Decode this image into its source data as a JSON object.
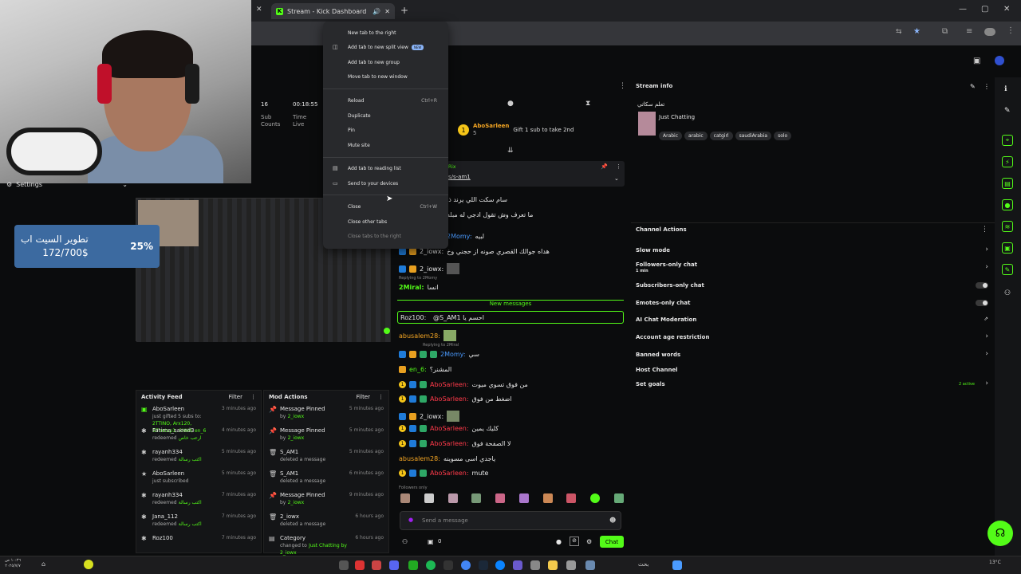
{
  "browser": {
    "tab_title": "Stream - Kick Dashboard",
    "close_tab_glyph": "✕",
    "new_tab_glyph": "+"
  },
  "context_menu": {
    "items": [
      {
        "label": "New tab to the right"
      },
      {
        "label": "Add tab to new split view",
        "badge": "NEW"
      },
      {
        "label": "Add tab to new group"
      },
      {
        "label": "Move tab to new window"
      },
      {
        "label": "Reload",
        "shortcut": "Ctrl+R"
      },
      {
        "label": "Duplicate"
      },
      {
        "label": "Pin"
      },
      {
        "label": "Mute site"
      },
      {
        "label": "Add tab to reading list"
      },
      {
        "label": "Send to your devices"
      },
      {
        "label": "Close",
        "shortcut": "Ctrl+W"
      },
      {
        "label": "Close other tabs"
      },
      {
        "label": "Close tabs to the right"
      }
    ]
  },
  "overlay": {
    "settings_label": "Settings",
    "goal_title": "تطوير السيت اب",
    "goal_amount": "172/700$",
    "goal_percent": "25%"
  },
  "stats": {
    "subs": "16",
    "subs_label": "Sub Counts",
    "time": "00:18:55",
    "time_label": "Time Live"
  },
  "activity_feed": {
    "title": "Activity Feed",
    "filter": "Filter",
    "items": [
      {
        "name": "AboSarleen",
        "desc": "just gifted 5 subs to:",
        "extra": "2TTINO, Arx120, B7ontop1, 6YAM, en_6",
        "time": "3 minutes ago"
      },
      {
        "name": "Fatima_saeed3",
        "desc": "redeemed",
        "extra": "ارعب خاص",
        "time": "4 minutes ago"
      },
      {
        "name": "rayanh334",
        "desc": "redeemed",
        "extra": "اكتب رسالة",
        "time": "5 minutes ago"
      },
      {
        "name": "AboSarleen",
        "desc": "just subscribed",
        "extra": "",
        "time": "5 minutes ago"
      },
      {
        "name": "rayanh334",
        "desc": "redeemed",
        "extra": "اكتب رسالة",
        "time": "7 minutes ago"
      },
      {
        "name": "Jana_112",
        "desc": "redeemed",
        "extra": "اكتب رسالة",
        "time": "7 minutes ago"
      },
      {
        "name": "Roz100",
        "desc": "",
        "extra": "",
        "time": "7 minutes ago"
      }
    ]
  },
  "mod_actions": {
    "title": "Mod Actions",
    "filter": "Filter",
    "items": [
      {
        "name": "Message Pinned",
        "desc": "by",
        "by": "2_iowx",
        "time": "5 minutes ago"
      },
      {
        "name": "Message Pinned",
        "desc": "by",
        "by": "2_iowx",
        "time": "5 minutes ago"
      },
      {
        "name": "S_AM1",
        "desc": "deleted a message",
        "by": "",
        "time": "5 minutes ago"
      },
      {
        "name": "S_AM1",
        "desc": "deleted a message",
        "by": "",
        "time": "6 minutes ago"
      },
      {
        "name": "Message Pinned",
        "desc": "by",
        "by": "2_iowx",
        "time": "9 minutes ago"
      },
      {
        "name": "2_iowx",
        "desc": "deleted a message",
        "by": "",
        "time": "6 hours ago"
      },
      {
        "name": "Category",
        "desc": "changed to",
        "by": "Just Chatting by 2_iowx",
        "time": "6 hours ago"
      }
    ]
  },
  "chat": {
    "gift_user": "AboSarleen",
    "gift_count": "5",
    "gift_text": "Gift 1 sub to take 2nd",
    "pinned_user": "Rix",
    "pinned_link": "s/s-am1",
    "new_messages": "New messages",
    "messages": [
      {
        "text": "سام سكت اللي يرند ذا"
      },
      {
        "text": "ما تعرف وش تقول ادجي له مبله"
      },
      {
        "user": "2Momy:",
        "text": "لبيه"
      },
      {
        "user": "2_iowx:",
        "text": "هداه جوالك القصري صونه از حجني وخ"
      },
      {
        "user": "2_iowx:",
        "text": ""
      },
      {
        "reply": "Replying to 2Momy",
        "user": "2Miral:",
        "text": "انسا"
      },
      {
        "user": "Roz100:",
        "text": "@S_AM1 احسم يا"
      },
      {
        "user": "abusalem28:",
        "text": ""
      },
      {
        "reply": "Replying to 2Miral",
        "user": "2Momy:",
        "text": "سي"
      },
      {
        "user": "en_6:",
        "text": "المشنر؟"
      },
      {
        "user": "AboSarleen:",
        "text": "من فوق تسوي ميوت"
      },
      {
        "user": "AboSarleen:",
        "text": "اضغط من فوق"
      },
      {
        "user": "2_iowx:",
        "text": ""
      },
      {
        "user": "AboSarleen:",
        "text": "كليك يمين"
      },
      {
        "user": "AboSarleen:",
        "text": "لا الصفحة فوق"
      },
      {
        "user": "abusalem28:",
        "text": "ياجدي اسى مسوينه"
      },
      {
        "user": "AboSarleen:",
        "text": "mute"
      }
    ],
    "followers_only": "Followers only",
    "input_placeholder": "Send a message",
    "count": "0",
    "send_label": "Chat"
  },
  "stream_info": {
    "title": "Stream info",
    "stream_title": "تعلم سكاتي",
    "category": "Just Chatting",
    "tags": [
      "Arabic",
      "arabic",
      "catgirl",
      "saudiArabia",
      "solo"
    ]
  },
  "channel_actions": {
    "title": "Channel Actions",
    "rows": [
      {
        "label": "Slow mode"
      },
      {
        "label": "Followers-only chat",
        "sub": "1 min"
      },
      {
        "label": "Subscribers-only chat"
      },
      {
        "label": "Emotes-only chat"
      },
      {
        "label": "AI Chat Moderation"
      },
      {
        "label": "Account age restriction"
      },
      {
        "label": "Banned words"
      },
      {
        "label": "Host Channel"
      },
      {
        "label": "Set goals",
        "sub": "2 active"
      }
    ]
  },
  "taskbar": {
    "time": "١٠:٢٦ ص",
    "date": "٢٠٢٥/٧/٧",
    "search": "بحث",
    "weather": "13°C"
  },
  "colors": {
    "accent": "#53fc18",
    "goal_bg": "#3c6aa0"
  }
}
